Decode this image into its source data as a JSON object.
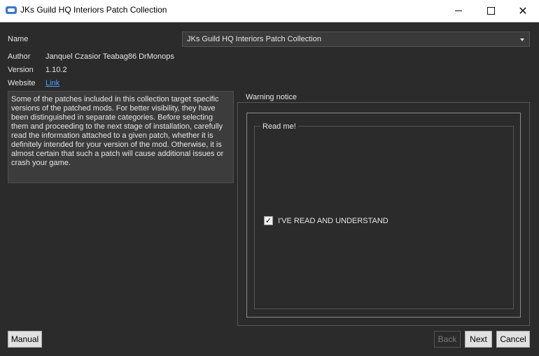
{
  "window": {
    "title": "JKs Guild HQ Interiors Patch Collection",
    "icon": "app-icon",
    "controls": {
      "minimize": "minimize-icon",
      "maximize": "maximize-icon",
      "close": "close-icon"
    }
  },
  "info": {
    "name_label": "Name",
    "name_value": "JKs Guild HQ Interiors Patch Collection",
    "author_label": "Author",
    "author_value": "Janquel Czasior Teabag86 DrMonops",
    "version_label": "Version",
    "version_value": "1.10.2",
    "website_label": "Website",
    "website_link": "Link"
  },
  "description": "Some of the patches included in this collection target specific versions of the patched mods. For better visibility, they have been distinguished in separate categories. Before selecting them and proceeding to the next stage of installation, carefully read the information attached to a given patch, whether it is definitely intended for your version of the mod. Otherwise, it is almost certain that such a patch will cause additional issues or crash your game.",
  "warning": {
    "group_title": "Warning notice",
    "readme_title": "Read me!",
    "checkbox_label": "I'VE READ AND UNDERSTAND",
    "checkbox_checked": true
  },
  "buttons": {
    "manual": "Manual",
    "back": "Back",
    "next": "Next",
    "cancel": "Cancel"
  },
  "colors": {
    "background": "#2b2b2b",
    "link": "#4aa3ff",
    "textbox": "#3c3c3c"
  }
}
